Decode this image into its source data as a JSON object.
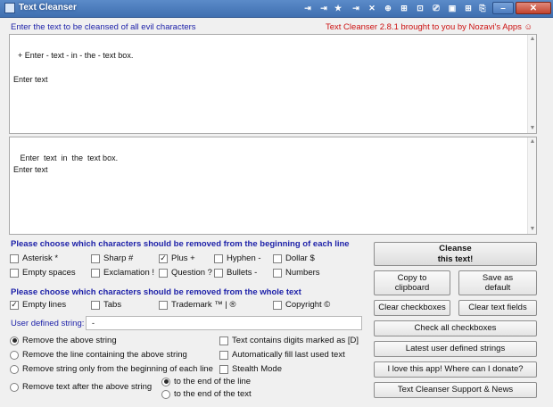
{
  "window": {
    "title": "Text Cleanser",
    "titlebar_buttons": [
      "⇥",
      "⇥",
      "★",
      "⇥",
      "✕",
      "⊕",
      "⊞",
      "⊡",
      "⎚",
      "▣",
      "⊞",
      "⎘"
    ],
    "close_label": "✕"
  },
  "header": {
    "instruction": "Enter the text to be cleansed of all evil characters",
    "credit": "Text Cleanser 2.8.1 brought to you by Nozavi's Apps ☺"
  },
  "input_box": {
    "text": "+ Enter - text - in - the - text box.\n\nEnter text"
  },
  "output_box": {
    "text": " Enter  text  in  the  text box.\nEnter text"
  },
  "section_beginning": {
    "title": "Please choose which characters should be removed from the beginning of each line",
    "options": [
      {
        "label": "Asterisk *",
        "checked": false
      },
      {
        "label": "Sharp #",
        "checked": false
      },
      {
        "label": "Plus +",
        "checked": true
      },
      {
        "label": "Hyphen -",
        "checked": false
      },
      {
        "label": "Dollar $",
        "checked": false
      },
      {
        "label": "Empty spaces",
        "checked": false
      },
      {
        "label": "Exclamation !",
        "checked": false
      },
      {
        "label": "Question ?",
        "checked": false
      },
      {
        "label": "Bullets -",
        "checked": false
      },
      {
        "label": "Numbers",
        "checked": false
      }
    ]
  },
  "section_whole": {
    "title": "Please choose which characters should be removed from the whole text",
    "options": [
      {
        "label": "Empty lines",
        "checked": true
      },
      {
        "label": "Tabs",
        "checked": false
      },
      {
        "label": "Trademark ™ | ®",
        "checked": false
      },
      {
        "label": "Copyright ©",
        "checked": false
      }
    ]
  },
  "user_defined": {
    "label": "User defined string:",
    "value": "-"
  },
  "radios": [
    {
      "label": "Remove the above string",
      "selected": true
    },
    {
      "label": "Remove the line containing the above string",
      "selected": false
    },
    {
      "label": "Remove string only from the beginning of each line",
      "selected": false
    },
    {
      "label": "Remove text after the above string",
      "selected": false
    }
  ],
  "sub_radios": [
    {
      "label": "to the end of the line",
      "selected": true
    },
    {
      "label": "to the end of the text",
      "selected": false
    }
  ],
  "extra_checkboxes": [
    {
      "label": "Text contains digits marked as [D]",
      "checked": false
    },
    {
      "label": "Automatically fill last used text",
      "checked": false
    },
    {
      "label": "Stealth Mode",
      "checked": false
    }
  ],
  "buttons": {
    "cleanse": "Cleanse\nthis text!",
    "copy": "Copy to\nclipboard",
    "save_default": "Save as\ndefault",
    "clear_checkboxes": "Clear checkboxes",
    "clear_text": "Clear text fields",
    "check_all": "Check all checkboxes",
    "latest": "Latest user defined strings",
    "donate": "I love this app! Where can I donate?",
    "support": "Text Cleanser Support & News"
  }
}
